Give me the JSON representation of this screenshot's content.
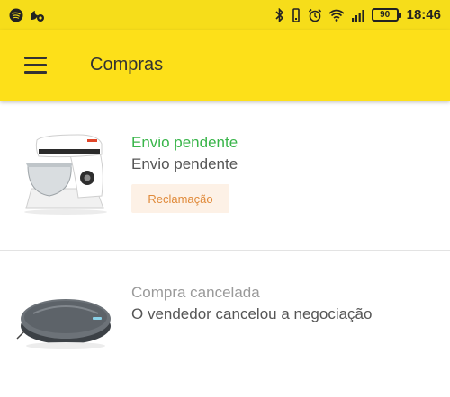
{
  "status_bar": {
    "time": "18:46",
    "battery": "90",
    "left_icons": [
      "spotify-icon",
      "notification-icon"
    ],
    "right_icons": [
      "bluetooth-icon",
      "vibrate-icon",
      "alarm-icon",
      "wifi-icon",
      "signal-icon",
      "battery-icon"
    ]
  },
  "app_bar": {
    "title": "Compras",
    "menu_icon": "hamburger-menu-icon",
    "color": "#fde019"
  },
  "purchases": [
    {
      "status": "Envio pendente",
      "status_color": "#39b54a",
      "detail": "Envio pendente",
      "action_label": "Reclamação",
      "image": "stand-mixer-product-image"
    },
    {
      "status": "Compra cancelada",
      "status_color": "#9a9a9a",
      "detail": "O vendedor cancelou a negociação",
      "image": "robot-vacuum-product-image"
    }
  ]
}
